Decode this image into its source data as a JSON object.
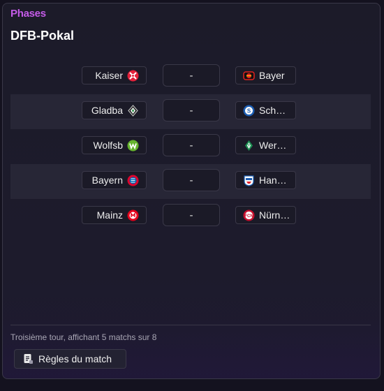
{
  "header": {
    "section_label": "Phases",
    "title": "DFB-Pokal"
  },
  "matches": [
    {
      "home": {
        "name": "Kaiser",
        "crest": "kaiserslautern-crest-icon",
        "color": "#e4203a"
      },
      "score": "-",
      "away": {
        "name": "Bayer",
        "crest": "leverkusen-crest-icon",
        "color": "#e32221"
      }
    },
    {
      "home": {
        "name": "Gladba",
        "crest": "gladbach-crest-icon",
        "color": "#9a9a9a"
      },
      "score": "-",
      "away": {
        "name": "Sch…",
        "crest": "schalke-crest-icon",
        "color": "#1d5fb4"
      }
    },
    {
      "home": {
        "name": "Wolfsb",
        "crest": "wolfsburg-crest-icon",
        "color": "#65b32e"
      },
      "score": "-",
      "away": {
        "name": "Wer…",
        "crest": "werder-crest-icon",
        "color": "#1d9053"
      }
    },
    {
      "home": {
        "name": "Bayern",
        "crest": "bayern-crest-icon",
        "color": "#dc052d"
      },
      "score": "-",
      "away": {
        "name": "Han…",
        "crest": "hansa-crest-icon",
        "color": "#e2202a"
      }
    },
    {
      "home": {
        "name": "Mainz",
        "crest": "mainz-crest-icon",
        "color": "#e3001b"
      },
      "score": "-",
      "away": {
        "name": "Nürn…",
        "crest": "nurnberg-crest-icon",
        "color": "#c8102e"
      }
    }
  ],
  "footer": {
    "status_text": "Troisième tour, affichant 5 matchs sur 8",
    "rules_button_label": "Règles du match",
    "rules_button_icon": "rules-document-icon"
  },
  "colors": {
    "accent": "#c45be8",
    "panel_bg": "#1c1b29",
    "row_alt_bg": "#272636",
    "border": "#3a3848"
  }
}
